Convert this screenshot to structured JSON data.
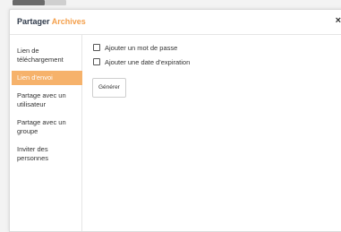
{
  "dialog": {
    "title_prefix": "Partager",
    "title_folder": "Archives",
    "close_label": "×"
  },
  "sidebar": {
    "items": [
      {
        "label": "Lien de téléchargement"
      },
      {
        "label": "Lien d'envoi",
        "active": true
      },
      {
        "label": "Partage avec un utilisateur"
      },
      {
        "label": "Partage avec un groupe"
      },
      {
        "label": "Inviter des personnes"
      }
    ]
  },
  "upload_link": {
    "options": [
      {
        "label": "Ajouter un mot de passe",
        "checked": false
      },
      {
        "label": "Ajouter une date d'expiration",
        "checked": false
      }
    ],
    "generate_label": "Générer"
  },
  "colors": {
    "accent": "#f4a04c",
    "active_item_bg": "#f6b26b",
    "title_text": "#2f3a4a"
  }
}
